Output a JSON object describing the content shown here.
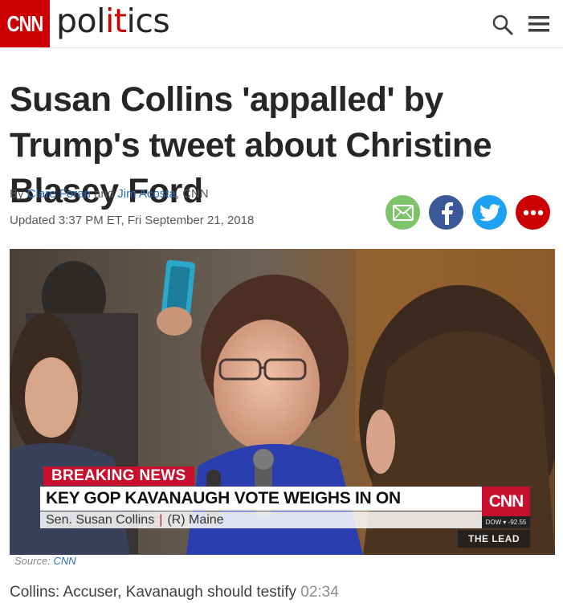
{
  "header": {
    "logo_text": "CNN",
    "section_prefix": "pol",
    "section_accent": "it",
    "section_suffix": "ics",
    "accent_color": "#cc0000",
    "search_icon": "search-icon",
    "menu_icon": "hamburger-menu-icon"
  },
  "article": {
    "headline": "Susan Collins 'appalled' by Trump's tweet about Christine Blasey Ford",
    "byline_prefix": "By",
    "author_1": "Clare Foran",
    "byline_and": "and",
    "author_2": "Jim Acosta",
    "byline_suffix": ", CNN",
    "updated": "Updated 3:37 PM ET, Fri September 21, 2018"
  },
  "share": {
    "email_icon": "email-icon",
    "facebook_icon": "facebook-icon",
    "twitter_icon": "twitter-icon",
    "more_icon": "more-icon",
    "colors": {
      "email": "#7cc36a",
      "facebook": "#3b5998",
      "twitter": "#1da1f2",
      "more": "#cc0000"
    }
  },
  "video": {
    "breaking_label": "BREAKING NEWS",
    "chyron_headline": "KEY GOP KAVANAUGH VOTE WEIGHS IN ON ALLEGATIONS",
    "chyron_name": "Sen. Susan Collins",
    "chyron_party": "(R) Maine",
    "network_bug": "CNN",
    "ticker": "DOW ▾ -92.55",
    "show_name": "THE LEAD",
    "source_prefix": "Source:",
    "source_link": "CNN",
    "title": "Collins: Accuser, Kavanaugh should testify",
    "duration": "02:34"
  }
}
